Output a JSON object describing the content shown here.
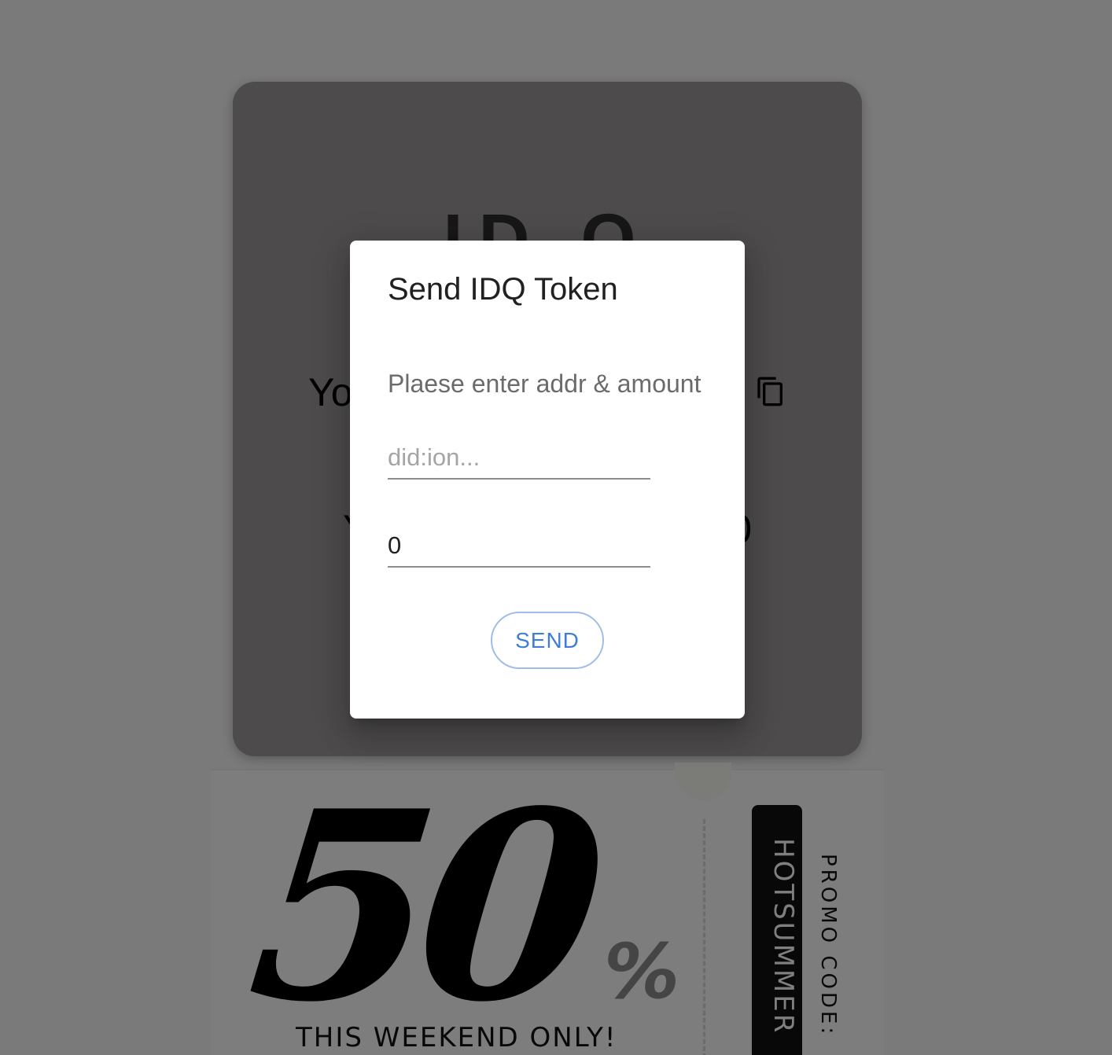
{
  "background": {
    "card": {
      "logo_text": "ID Q",
      "address_text": "You",
      "balance_left": "Y",
      "balance_right": "0",
      "copy_icon": "copy-icon"
    },
    "coupon": {
      "discount": "50",
      "percent_sign": "%",
      "tagline": "THIS WEEKEND ONLY!",
      "promo_label": "PROMO CODE:",
      "promo_code": "HOTSUMMER"
    }
  },
  "dialog": {
    "title": "Send IDQ Token",
    "content_text": "Plaese enter addr & amount",
    "address_field": {
      "value": "",
      "placeholder": "did:ion..."
    },
    "amount_field": {
      "value": "0"
    },
    "send_label": "SEND"
  },
  "colors": {
    "overlay": "rgba(0,0,0,0.5)",
    "accent": "#3f7ed6",
    "button_border": "#9fbde8"
  }
}
